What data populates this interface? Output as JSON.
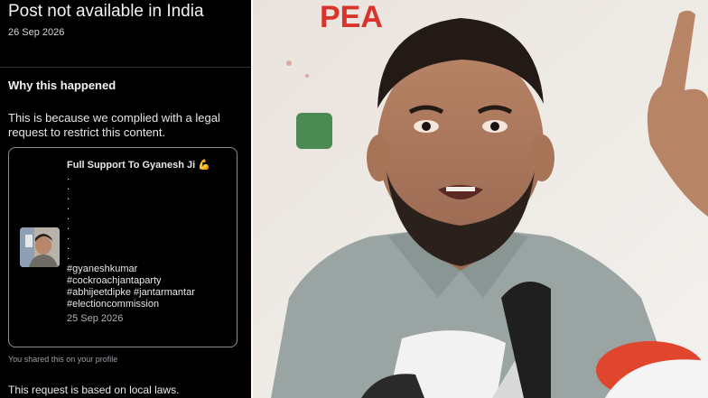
{
  "notice": {
    "title": "Post not available in India",
    "date": "26 Sep 2026",
    "why_heading": "Why this happened",
    "explanation": "This is because we complied with a legal request to restrict this content.",
    "shared_note": "You shared this on your profile",
    "local_laws": "This request is based on local laws."
  },
  "card": {
    "headline": "Full Support To Gyanesh Ji 💪",
    "dots": [
      ".",
      ".",
      ".",
      ".",
      ".",
      ".",
      ".",
      ".",
      "."
    ],
    "hashtags": [
      "#gyaneshkumar",
      "#cockroachjantaparty",
      "#abhijeetdipke #jantarmantar",
      "#electioncommission"
    ],
    "date": "25 Sep 2026"
  },
  "photo": {
    "banner_text": "PEA"
  },
  "colors": {
    "background": "#000000",
    "card_border": "#8b8f93",
    "banner_red": "#d9342b",
    "shirt": "#9aa5a3"
  }
}
